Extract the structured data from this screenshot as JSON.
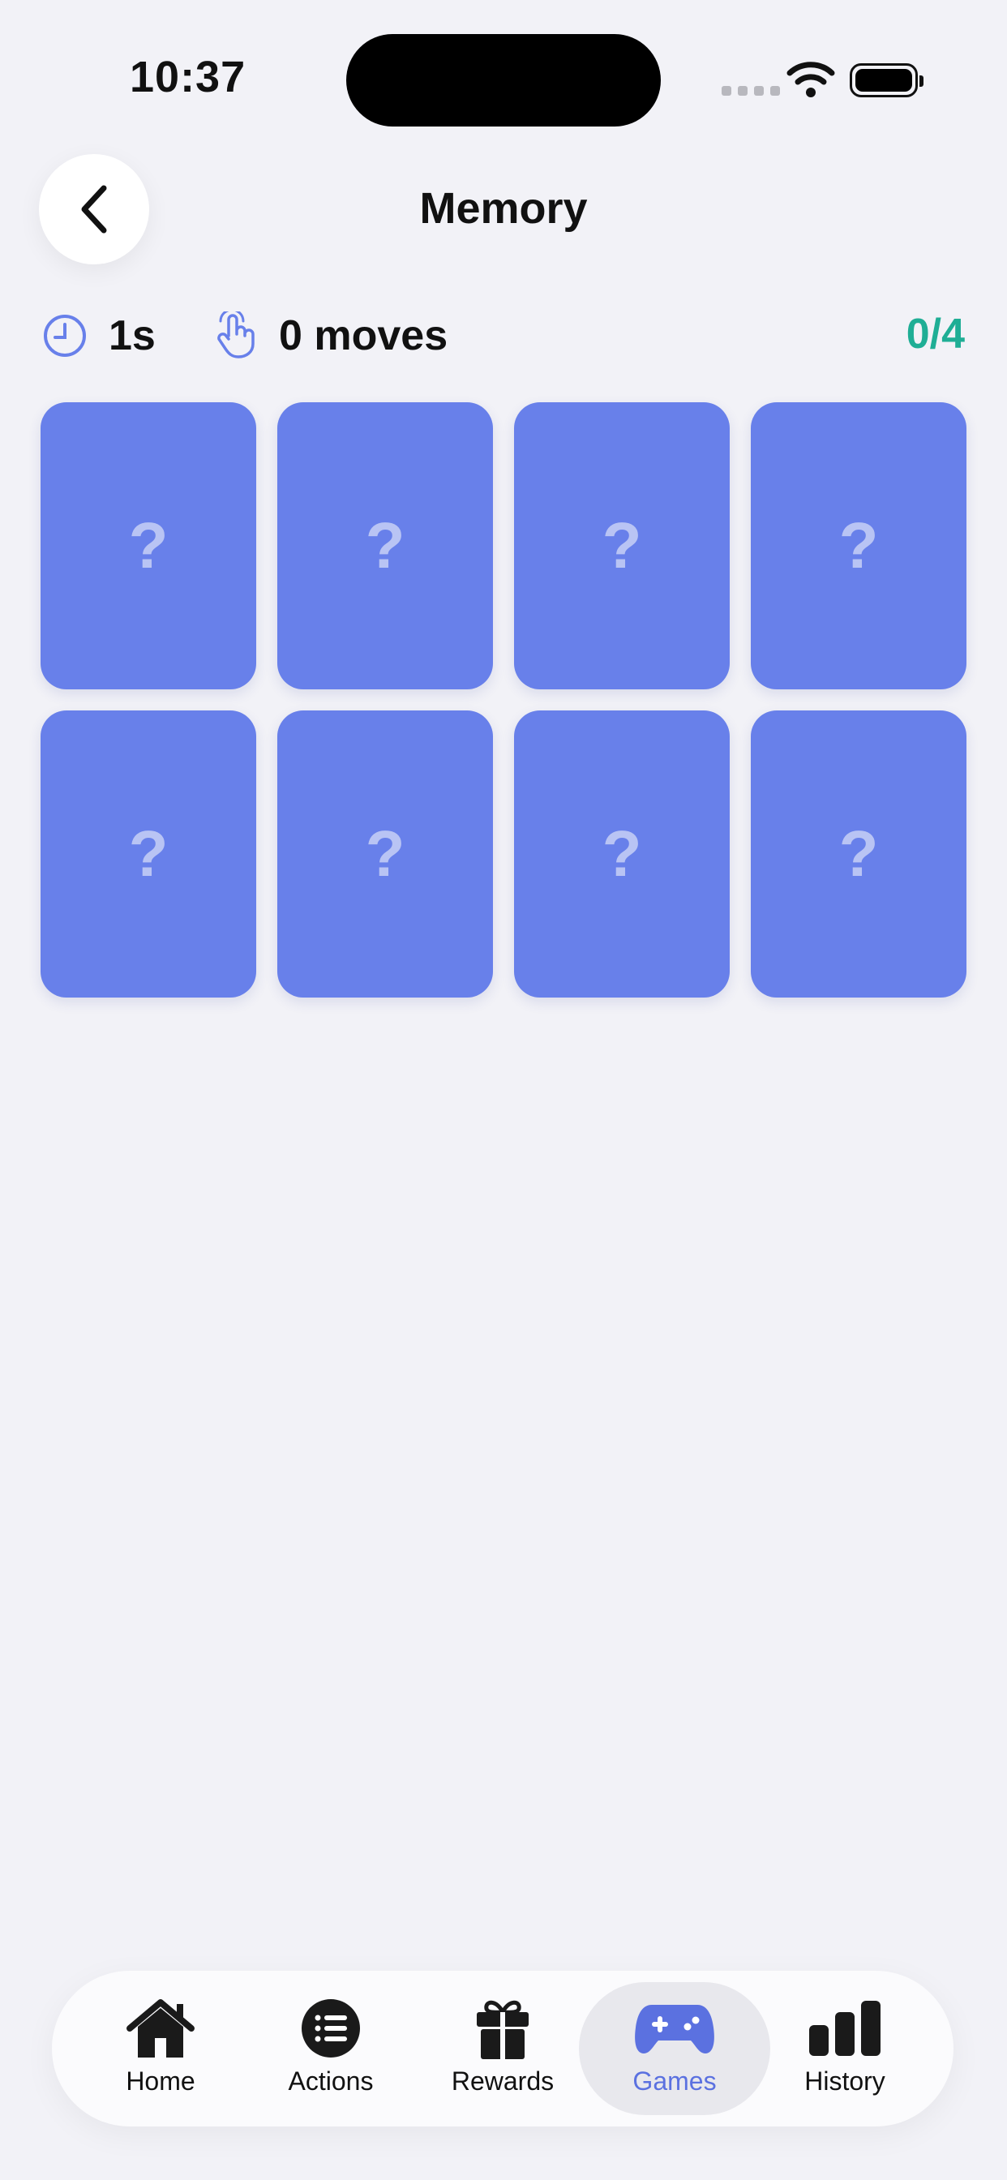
{
  "status_bar": {
    "time": "10:37"
  },
  "header": {
    "title": "Memory"
  },
  "stats": {
    "time": "1s",
    "moves": "0 moves",
    "progress": "0/4"
  },
  "cards": [
    "?",
    "?",
    "?",
    "?",
    "?",
    "?",
    "?",
    "?"
  ],
  "tabbar": {
    "items": [
      {
        "label": "Home",
        "icon": "house-icon"
      },
      {
        "label": "Actions",
        "icon": "list-icon"
      },
      {
        "label": "Rewards",
        "icon": "gift-icon"
      },
      {
        "label": "Games",
        "icon": "gamecontroller-icon",
        "active": true
      },
      {
        "label": "History",
        "icon": "bar-chart-icon"
      }
    ]
  },
  "colors": {
    "accent": "#6880ea",
    "progress": "#1fae95",
    "background": "#f2f2f7"
  }
}
